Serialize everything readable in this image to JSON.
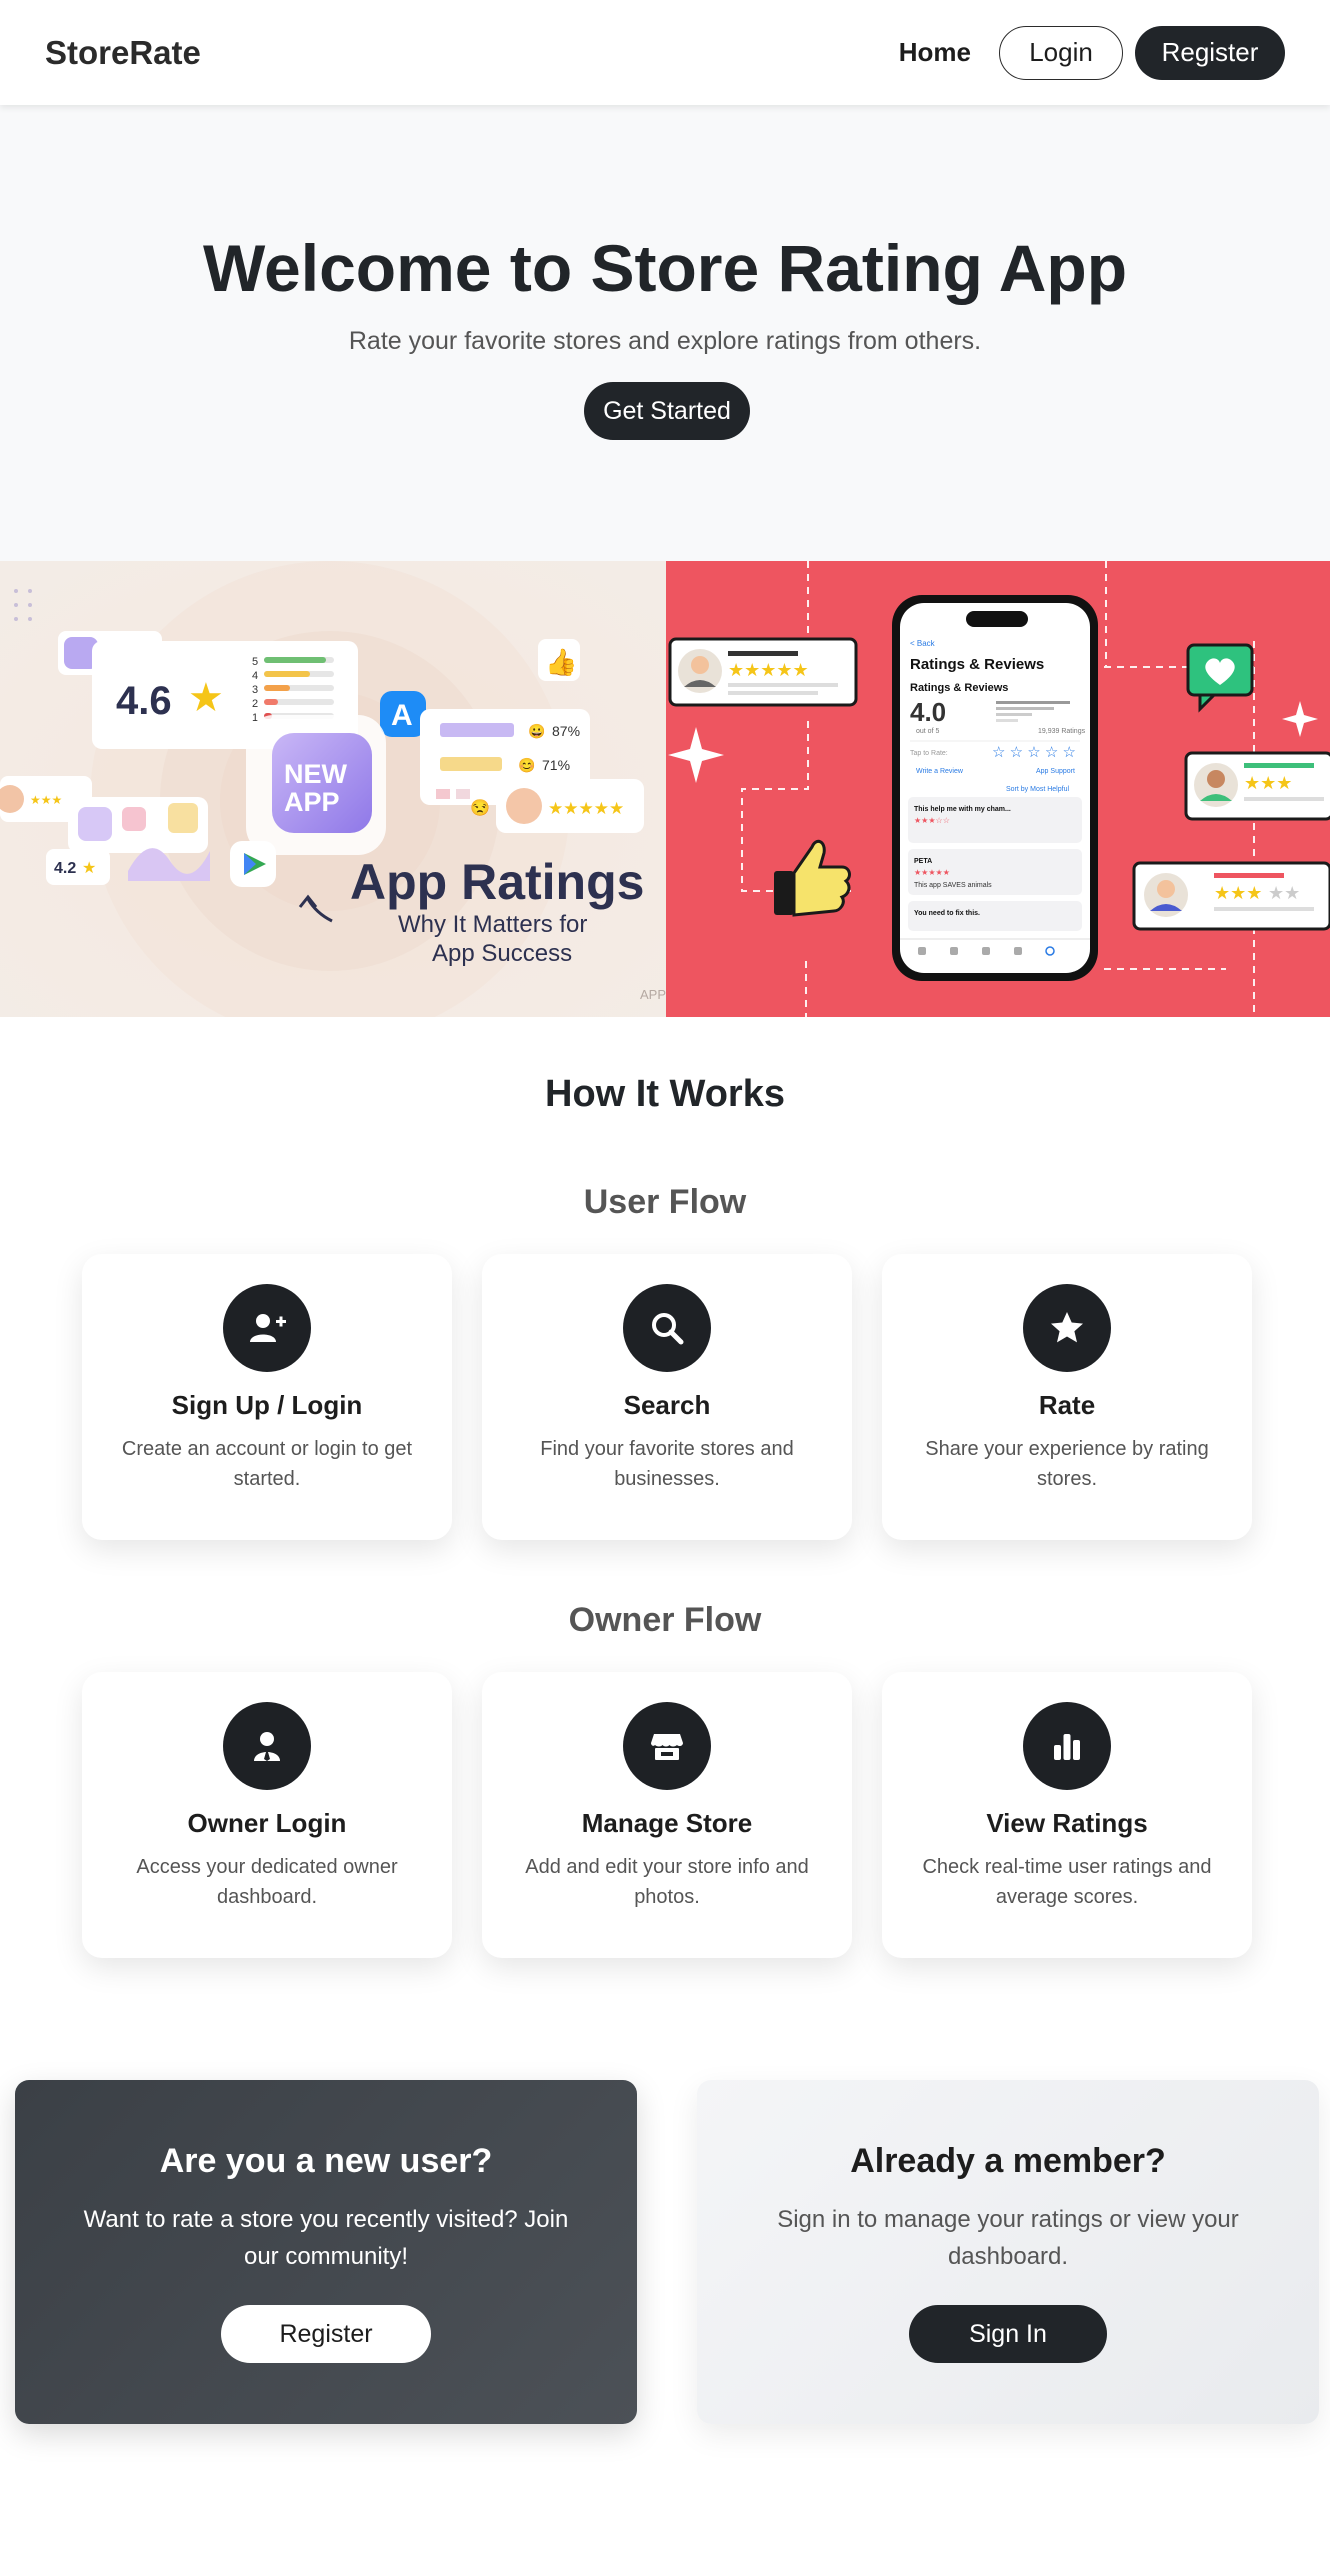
{
  "navbar": {
    "brand": "StoreRate",
    "home": "Home",
    "login": "Login",
    "register": "Register"
  },
  "hero": {
    "title": "Welcome to Store Rating App",
    "subtitle": "Rate your favorite stores and explore ratings from others.",
    "cta": "Get Started"
  },
  "banner_left": {
    "rating": "4.6",
    "rating_small": "4.2",
    "badge": "NEW APP",
    "badge_line1": "NEW",
    "badge_line2": "APP",
    "pct_a": "87%",
    "pct_b": "71%",
    "bars": [
      "5",
      "4",
      "3",
      "2",
      "1"
    ],
    "headline": "App Ratings",
    "tagline_1": "Why It Matters for",
    "tagline_2": "App Success",
    "watermark": "APP"
  },
  "banner_right": {
    "phone_back": "< Back",
    "phone_header": "Ratings & Reviews",
    "phone_subheader": "Ratings & Reviews",
    "phone_score": "4.0",
    "phone_outof": "out of 5",
    "phone_count": "19,939 Ratings",
    "phone_tap": "Tap to Rate:",
    "phone_write": "Write a Review",
    "phone_support": "App Support",
    "phone_sort": "Sort by Most Helpful",
    "review1_title": "This help me with my cham...",
    "review2_title": "PETA",
    "review2_text": "This app SAVES animals",
    "review3_title": "You need to fix this."
  },
  "how": {
    "title": "How It Works",
    "user_flow": "User Flow",
    "owner_flow": "Owner Flow",
    "user_cards": [
      {
        "title": "Sign Up / Login",
        "text": "Create an account or login to get started.",
        "icon": "user-plus-icon"
      },
      {
        "title": "Search",
        "text": "Find your favorite stores and businesses.",
        "icon": "search-icon"
      },
      {
        "title": "Rate",
        "text": "Share your experience by rating stores.",
        "icon": "star-icon"
      }
    ],
    "owner_cards": [
      {
        "title": "Owner Login",
        "text": "Access your dedicated owner dashboard.",
        "icon": "user-tie-icon"
      },
      {
        "title": "Manage Store",
        "text": "Add and edit your store info and photos.",
        "icon": "store-icon"
      },
      {
        "title": "View Ratings",
        "text": "Check real-time user ratings and average scores.",
        "icon": "bar-chart-icon"
      }
    ]
  },
  "cta": {
    "new_title": "Are you a new user?",
    "new_text": "Want to rate a store you recently visited? Join our community!",
    "new_button": "Register",
    "member_title": "Already a member?",
    "member_text": "Sign in to manage your ratings or view your dashboard.",
    "member_button": "Sign In"
  },
  "colors": {
    "dark": "#212529",
    "hero_bg": "#f8f9fa",
    "banner_right_bg": "#ee5560",
    "star": "#f5c518"
  }
}
